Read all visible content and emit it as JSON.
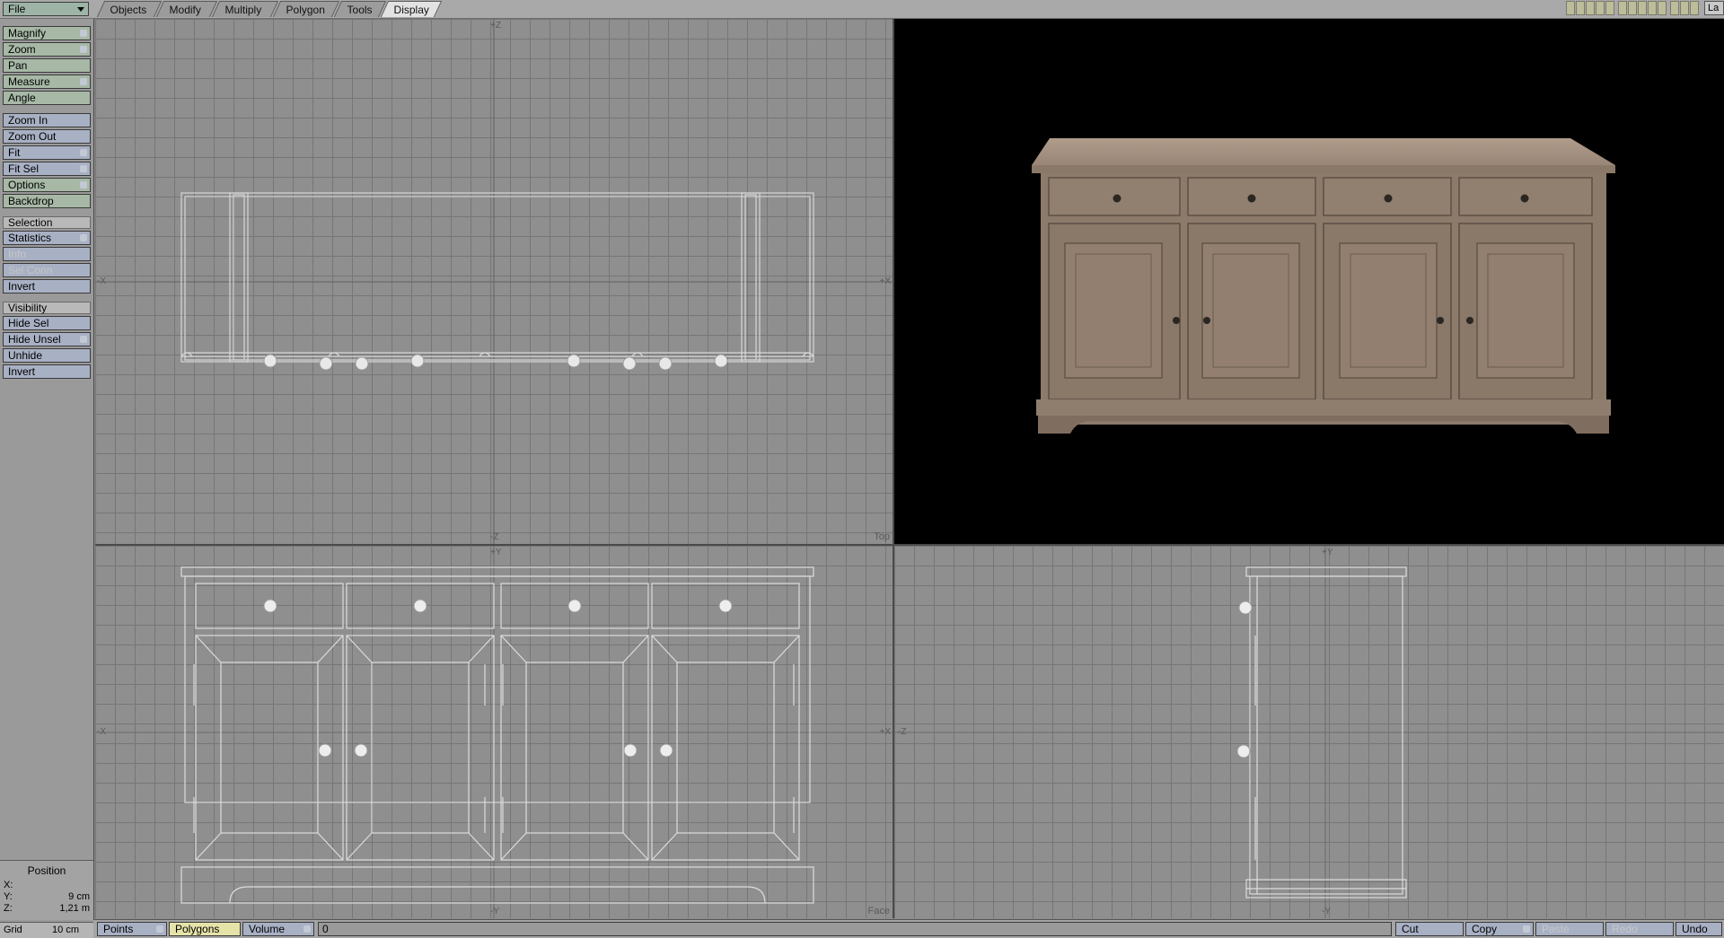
{
  "topbar": {
    "file_menu": "File",
    "tabs": [
      {
        "label": "Objects",
        "active": false
      },
      {
        "label": "Modify",
        "active": false
      },
      {
        "label": "Multiply",
        "active": false
      },
      {
        "label": "Polygon",
        "active": false
      },
      {
        "label": "Tools",
        "active": false
      },
      {
        "label": "Display",
        "active": true
      }
    ],
    "layers_label": "La"
  },
  "sidebar": {
    "view_tools": [
      "Magnify",
      "Zoom",
      "Pan",
      "Measure",
      "Angle"
    ],
    "zoom_tools": [
      "Zoom In",
      "Zoom Out",
      "Fit",
      "Fit Sel",
      "Options",
      "Backdrop"
    ],
    "selection_header": "Selection",
    "selection_tools": [
      "Statistics",
      "Info",
      "Sel Conn",
      "Invert"
    ],
    "visibility_header": "Visibility",
    "visibility_tools": [
      "Hide Sel",
      "Hide Unsel",
      "Unhide",
      "Invert"
    ]
  },
  "position": {
    "title": "Position",
    "x_label": "X:",
    "x_value": "",
    "y_label": "Y:",
    "y_value": "9 cm",
    "z_label": "Z:",
    "z_value": "1,21 m",
    "grid_label": "Grid",
    "grid_value": "10 cm"
  },
  "viewports": {
    "top": {
      "name": "Top",
      "axis_up": "+Z",
      "axis_down": "-Z",
      "axis_left": "-X",
      "axis_right": "+X"
    },
    "face": {
      "name": "Face",
      "axis_up": "+Y",
      "axis_down": "-Y",
      "axis_left": "-X",
      "axis_right": "+X"
    },
    "side": {
      "name": "",
      "axis_up": "+Y",
      "axis_down": "-Y",
      "axis_left": "-Z",
      "axis_right": ""
    },
    "perspective": {
      "object_color": "#8c7a6b",
      "background": "#000000"
    }
  },
  "bottombar": {
    "modes": [
      {
        "label": "Points",
        "active": false
      },
      {
        "label": "Polygons",
        "active": true
      },
      {
        "label": "Volume",
        "active": false
      }
    ],
    "field_value": "0",
    "edit_buttons": [
      {
        "label": "Cut",
        "enabled": true
      },
      {
        "label": "Copy",
        "enabled": true
      },
      {
        "label": "Paste",
        "enabled": false
      },
      {
        "label": "Redo",
        "enabled": false
      },
      {
        "label": "Undo",
        "enabled": true
      }
    ]
  }
}
